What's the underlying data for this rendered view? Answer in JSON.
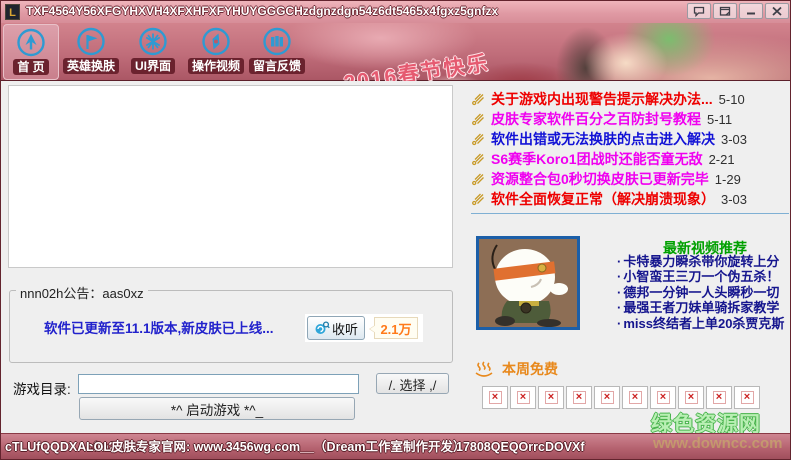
{
  "window": {
    "title": "TXF4564Y56XFGYHXVH4XFXHFXFYHUYGGGCHzdgnzdgn54z6dt5465x4fgxz5gnfzx",
    "logo_letter": "L"
  },
  "toolbar": {
    "banner": "2016春节快乐",
    "items": [
      {
        "label": "首 页"
      },
      {
        "label": "英雄换肤"
      },
      {
        "label": "UI界面"
      },
      {
        "label": "操作视频"
      },
      {
        "label": "留言反馈"
      }
    ]
  },
  "news": {
    "items": [
      {
        "title": "关于游戏内出现警告提示解决办法...",
        "date": "5-10",
        "color": "#ee0000"
      },
      {
        "title": "皮肤专家软件百分之百防封号教程",
        "date": "5-11",
        "color": "#f000f0"
      },
      {
        "title": "软件出错或无法换肤的点击进入解决",
        "date": "3-03",
        "color": "#1212d6"
      },
      {
        "title": "S6赛季Koro1团战时还能否童无敌",
        "date": "2-21",
        "color": "#f000f0"
      },
      {
        "title": "资源整合包0秒切换皮肤已更新完毕",
        "date": "1-29",
        "color": "#f000f0"
      },
      {
        "title": "软件全面恢复正常（解决崩溃现象）",
        "date": "3-03",
        "color": "#ee0000"
      }
    ]
  },
  "videos": {
    "title": "最新视频推荐",
    "items": [
      "卡特暴力瞬杀带你旋转上分",
      "小智蛮王三刀一个伪五杀！",
      "德邦一分钟一人头瞬秒一切",
      "最强王者刀妹单骑拆家教学",
      "miss终结者上单20杀贾克斯"
    ]
  },
  "free_week": {
    "title": "本周免费",
    "broken_mark": "×"
  },
  "announcement": {
    "box_title": "nnn02h公告：aas0xz",
    "message": "软件已更新至11.1版本,新皮肤已上线...",
    "listen_label": "收听",
    "listen_count": "2.1万"
  },
  "launcher": {
    "dir_label": "游戏目录:",
    "dir_value": "",
    "browse_label": "/. 选择 ,/",
    "launch_label": "*^ 启动游戏 *^_"
  },
  "statusbar": {
    "left": "cTLUfQQDXAcfm26632",
    "middle": "LOL皮肤专家官网: www.3456wg.com__（Dream工作室制作开发）",
    "right": "17808QEQOrrcDOVXf"
  },
  "watermarks": {
    "site": "绿色资源网",
    "downcc": "www.downcc.com"
  }
}
